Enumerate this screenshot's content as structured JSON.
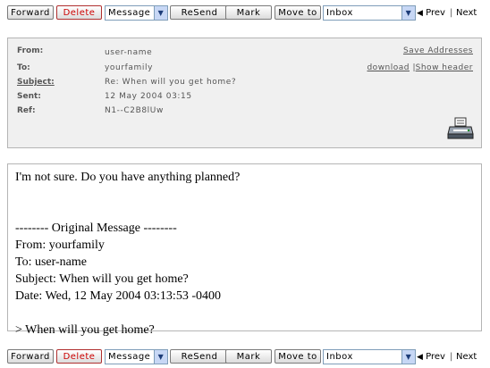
{
  "toolbar": {
    "forward": "Forward",
    "delete": "Delete",
    "action_select": "Message",
    "resend": "ReSend",
    "mark": "Mark",
    "move_to": "Move to",
    "folder_select": "Inbox",
    "prev": "Prev",
    "next": "Next",
    "separator": "|"
  },
  "header": {
    "from_label": "From:",
    "from_value": "user-name",
    "to_label": "To:",
    "to_value": "yourfamily",
    "subject_label": "Subject:",
    "subject_value": "Re: When will you get home?",
    "sent_label": "Sent:",
    "sent_value": "12 May 2004 03:15",
    "ref_label": "Ref:",
    "ref_value": "N1--C2B8lUw",
    "save_addresses": "Save Addresses",
    "download": "download",
    "link_sep": "|",
    "show_header": "Show header"
  },
  "message": {
    "body_lines": [
      "I'm not sure. Do you have anything planned?",
      "",
      "",
      "-------- Original Message --------",
      "From: yourfamily",
      "To: user-name",
      "Subject: When will you get home?",
      "Date: Wed, 12 May 2004 03:13:53 -0400",
      "",
      "> When will you get home?"
    ]
  },
  "icons": {
    "printer": "printer-icon",
    "dropdown": "chevron-down-icon",
    "prev": "triangle-left-icon"
  }
}
